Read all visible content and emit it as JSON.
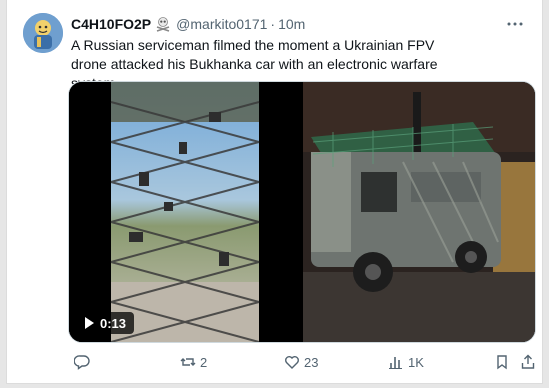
{
  "post": {
    "author_name": "C4H10FO2P",
    "handle": "@markito0171",
    "separator": "·",
    "time": "10m",
    "text": "A Russian serviceman filmed the moment a Ukrainian FPV drone attacked his Bukhanka car with an electronic warfare system"
  },
  "media": {
    "video_duration": "0:13"
  },
  "actions": {
    "reposts": "2",
    "likes": "23",
    "views": "1K"
  },
  "icons": [
    "avatar",
    "skull-crossbones-badge-icon",
    "more-icon",
    "play-icon",
    "reply-icon",
    "repost-icon",
    "like-icon",
    "views-icon",
    "bookmark-icon",
    "share-icon"
  ],
  "colors": {
    "text": "#0f1419",
    "muted": "#536471",
    "border": "#cfd9de"
  }
}
